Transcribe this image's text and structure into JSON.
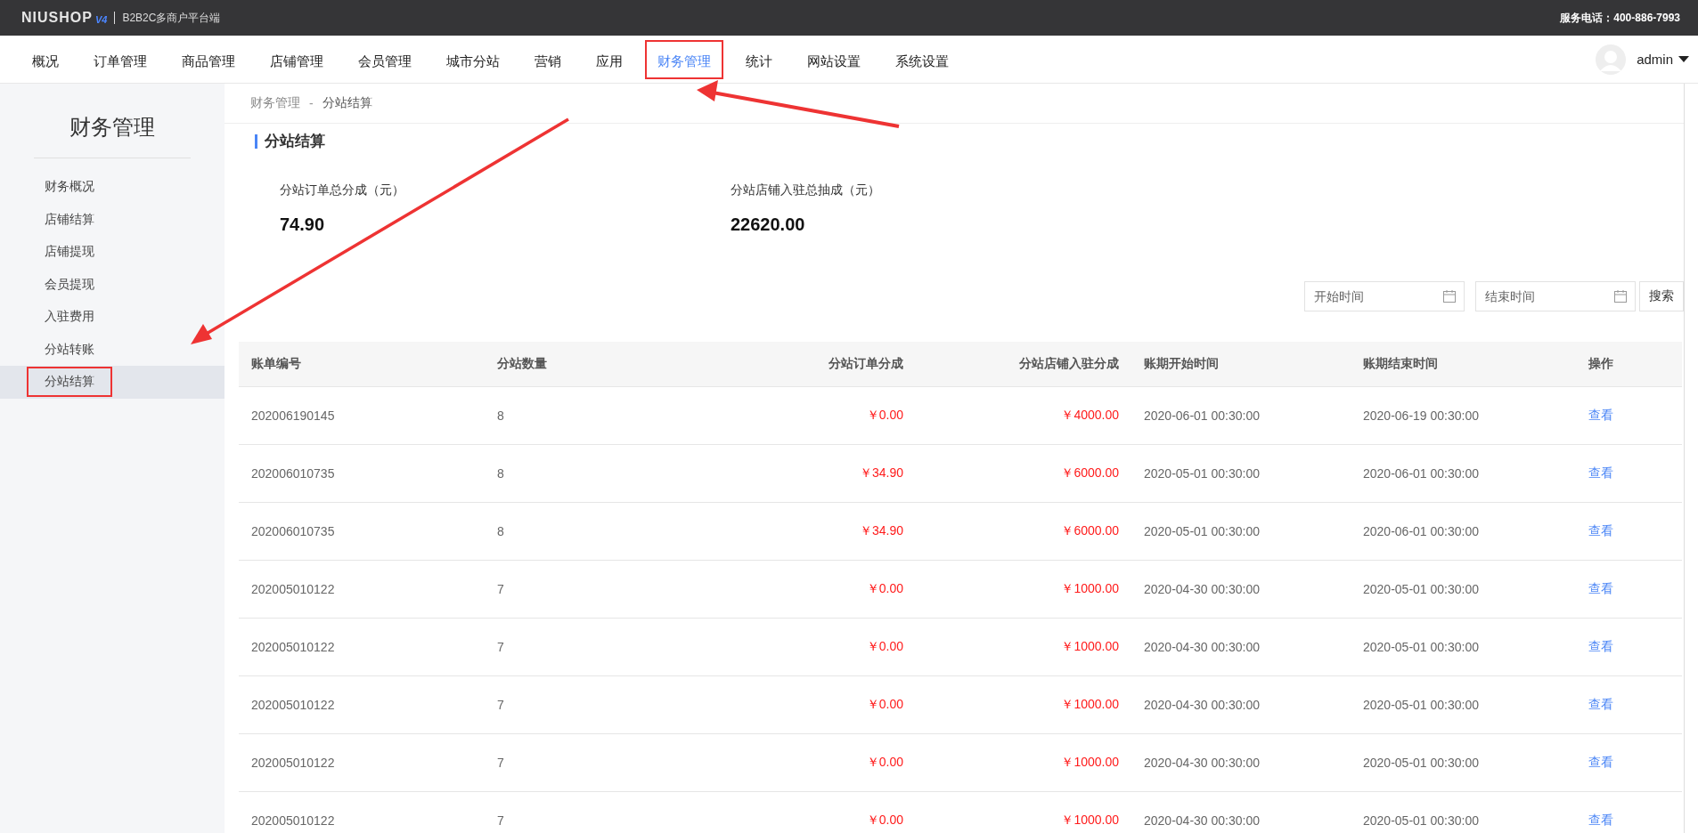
{
  "top_bar": {
    "logo": "NIUSHOP",
    "logo_version": "V4",
    "platform": "B2B2C多商户平台端",
    "service_phone": "服务电话：400-886-7993"
  },
  "nav": [
    {
      "label": "概况",
      "selected": false,
      "highlighted": false
    },
    {
      "label": "订单管理",
      "selected": false,
      "highlighted": false
    },
    {
      "label": "商品管理",
      "selected": false,
      "highlighted": false
    },
    {
      "label": "店铺管理",
      "selected": false,
      "highlighted": false
    },
    {
      "label": "会员管理",
      "selected": false,
      "highlighted": false
    },
    {
      "label": "城市分站",
      "selected": false,
      "highlighted": false
    },
    {
      "label": "营销",
      "selected": false,
      "highlighted": false
    },
    {
      "label": "应用",
      "selected": false,
      "highlighted": false
    },
    {
      "label": "财务管理",
      "selected": true,
      "highlighted": true
    },
    {
      "label": "统计",
      "selected": false,
      "highlighted": false
    },
    {
      "label": "网站设置",
      "selected": false,
      "highlighted": false
    },
    {
      "label": "系统设置",
      "selected": false,
      "highlighted": false
    }
  ],
  "user": {
    "name": "admin"
  },
  "sidebar": {
    "title": "财务管理",
    "items": [
      {
        "label": "财务概况",
        "selected": false,
        "highlighted": false
      },
      {
        "label": "店铺结算",
        "selected": false,
        "highlighted": false
      },
      {
        "label": "店铺提现",
        "selected": false,
        "highlighted": false
      },
      {
        "label": "会员提现",
        "selected": false,
        "highlighted": false
      },
      {
        "label": "入驻费用",
        "selected": false,
        "highlighted": false
      },
      {
        "label": "分站转账",
        "selected": false,
        "highlighted": false
      },
      {
        "label": "分站结算",
        "selected": true,
        "highlighted": true
      }
    ]
  },
  "breadcrumb": [
    "财务管理",
    "分站结算"
  ],
  "breadcrumb_separator": "-",
  "section_title": "分站结算",
  "stats": [
    {
      "label": "分站订单总分成（元）",
      "value": "74.90"
    },
    {
      "label": "分站店铺入驻总抽成（元）",
      "value": "22620.00"
    }
  ],
  "filters": {
    "start_placeholder": "开始时间",
    "end_placeholder": "结束时间",
    "search_button": "搜索"
  },
  "table": {
    "columns": [
      "账单编号",
      "分站数量",
      "分站订单分成",
      "分站店铺入驻分成",
      "账期开始时间",
      "账期结束时间",
      "操作"
    ],
    "rows": [
      {
        "id": "202006190145",
        "count": "8",
        "order_share": "￥0.00",
        "settle_share": "￥4000.00",
        "start": "2020-06-01 00:30:00",
        "end": "2020-06-19 00:30:00",
        "action": "查看"
      },
      {
        "id": "202006010735",
        "count": "8",
        "order_share": "￥34.90",
        "settle_share": "￥6000.00",
        "start": "2020-05-01 00:30:00",
        "end": "2020-06-01 00:30:00",
        "action": "查看"
      },
      {
        "id": "202006010735",
        "count": "8",
        "order_share": "￥34.90",
        "settle_share": "￥6000.00",
        "start": "2020-05-01 00:30:00",
        "end": "2020-06-01 00:30:00",
        "action": "查看"
      },
      {
        "id": "202005010122",
        "count": "7",
        "order_share": "￥0.00",
        "settle_share": "￥1000.00",
        "start": "2020-04-30 00:30:00",
        "end": "2020-05-01 00:30:00",
        "action": "查看"
      },
      {
        "id": "202005010122",
        "count": "7",
        "order_share": "￥0.00",
        "settle_share": "￥1000.00",
        "start": "2020-04-30 00:30:00",
        "end": "2020-05-01 00:30:00",
        "action": "查看"
      },
      {
        "id": "202005010122",
        "count": "7",
        "order_share": "￥0.00",
        "settle_share": "￥1000.00",
        "start": "2020-04-30 00:30:00",
        "end": "2020-05-01 00:30:00",
        "action": "查看"
      },
      {
        "id": "202005010122",
        "count": "7",
        "order_share": "￥0.00",
        "settle_share": "￥1000.00",
        "start": "2020-04-30 00:30:00",
        "end": "2020-05-01 00:30:00",
        "action": "查看"
      },
      {
        "id": "202005010122",
        "count": "7",
        "order_share": "￥0.00",
        "settle_share": "￥1000.00",
        "start": "2020-04-30 00:30:00",
        "end": "2020-05-01 00:30:00",
        "action": "查看"
      }
    ]
  }
}
